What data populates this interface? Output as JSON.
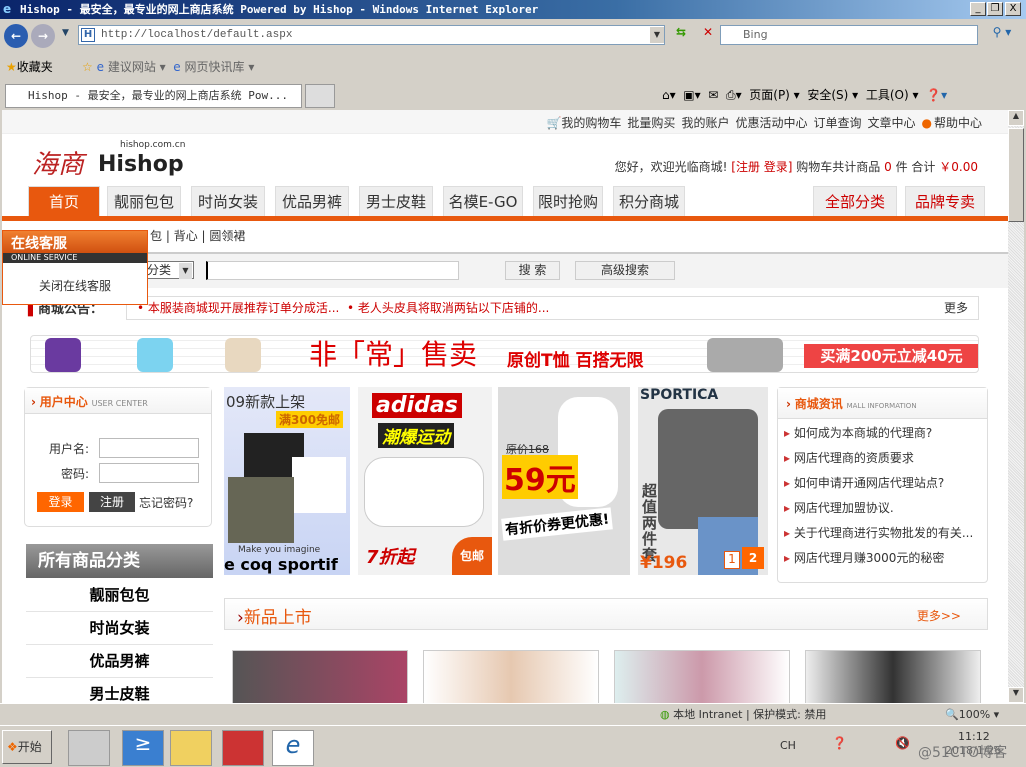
{
  "window": {
    "title": "Hishop - 最安全，最专业的网上商店系统 Powered by Hishop - Windows Internet Explorer",
    "min": "_",
    "restore": "❐",
    "close": "X"
  },
  "browser": {
    "url": "http://localhost/default.aspx",
    "search_placeholder": "Bing",
    "favorites": "收藏夹",
    "fav_items": [
      "建议网站 ▾",
      "网页快讯库 ▾"
    ],
    "tab_title": "Hishop - 最安全，最专业的网上商店系统 Pow...",
    "cmd": [
      "页面(P) ▾",
      "安全(S) ▾",
      "工具(O) ▾"
    ]
  },
  "site": {
    "top_links": [
      "我的购物车",
      "批量购买",
      "我的账户",
      "优惠活动中心",
      "订单查询",
      "文章中心",
      "帮助中心"
    ],
    "logo": {
      "cn": "海商",
      "en": "Hishop",
      "domain": "hishop.com.cn"
    },
    "welcome": "您好，欢迎光临商城!",
    "register_login": "[注册 登录]",
    "cart_text": "购物车共计商品",
    "cart_count": "0",
    "cart_unit": "件 合计",
    "cart_total": "￥0.00",
    "nav": [
      "首页",
      "靓丽包包",
      "时尚女装",
      "优品男裤",
      "男士皮鞋",
      "名模E-GO",
      "限时抢购",
      "积分商城"
    ],
    "nav_right": [
      "全部分类",
      "品牌专卖"
    ],
    "hot_keywords": [
      "| 背心",
      "| 圆领裙"
    ],
    "hot_keyword_partial": "包",
    "search_select": "分类",
    "search_btn": "搜 索",
    "adv_search_btn": "高级搜索",
    "notice_label": "商城公告：",
    "notices": [
      "本服装商城现开展推荐订单分成活...",
      "老人头皮具将取消两钻以下店铺的..."
    ],
    "notice_more": "更多",
    "banner": {
      "main": "非「常」售卖",
      "sub": "原创T恤 百搭无限",
      "promo": "买满200元立减40元"
    },
    "user_center": {
      "title": "用户中心",
      "en": "USER CENTER",
      "username_label": "用户名:",
      "password_label": "密码:",
      "login": "登录",
      "register": "注册",
      "forgot": "忘记密码?"
    },
    "categories_title": "所有商品分类",
    "categories": [
      "靓丽包包",
      "时尚女装",
      "优品男裤",
      "男士皮鞋"
    ],
    "promos": [
      {
        "a": "09新款上架",
        "b": "满300免邮",
        "c": "Make you imagine",
        "d": "e coq sportif"
      },
      {
        "a": "adidas",
        "b": "潮爆运动",
        "c": "7折起",
        "d": "包邮"
      },
      {
        "a": "原价168",
        "b": "59元",
        "c": "有折价券更优惠!"
      },
      {
        "a": "SPORTICA",
        "b": "超值两件套",
        "c": "¥196",
        "p1": "1",
        "p2": "2"
      }
    ],
    "mall_info": {
      "title": "商城资讯",
      "en": "MALL INFORMATION",
      "items": [
        "如何成为本商城的代理商?",
        "网店代理商的资质要求",
        "如何申请开通网店代理站点?",
        "网店代理加盟协议.",
        "关于代理商进行实物批发的有关...",
        "网店代理月赚3000元的秘密"
      ]
    },
    "new_arrivals": {
      "title": "新品上市",
      "more": "更多>>"
    },
    "online_service": {
      "title": "在线客服",
      "en": "ONLINE SERVICE",
      "close": "关闭在线客服"
    }
  },
  "status": {
    "zone": "本地 Intranet",
    "protected": "保护模式: 禁用",
    "zoom": "100%"
  },
  "taskbar": {
    "start": "开始",
    "lang": "CH",
    "time": "11:12",
    "date": "2018/1/26",
    "watermark": "@51CTO博客"
  }
}
